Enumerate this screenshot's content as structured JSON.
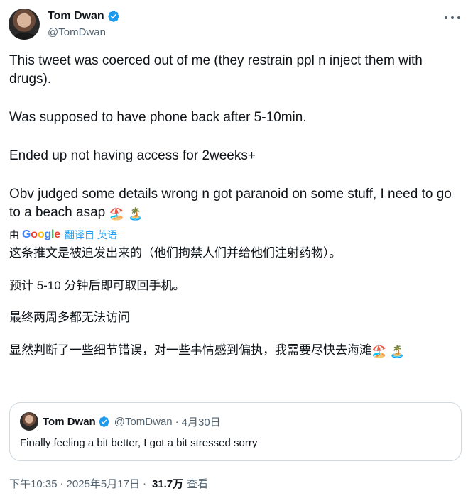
{
  "author": {
    "name": "Tom Dwan",
    "handle": "@TomDwan",
    "verified": true
  },
  "tweet": {
    "paragraphs": [
      "This tweet was coerced out of me (they restrain ppl n inject them with drugs).",
      "Was supposed to have phone back after 5-10min.",
      "Ended up not having access for 2weeks+",
      "Obv judged some details wrong n got paranoid on some stuff, I need to go to a beach asap"
    ],
    "emojis": [
      "🏖️",
      "🏝️"
    ]
  },
  "translation": {
    "by_label": "由",
    "provider": "Google",
    "link_label": "翻译自 英语",
    "paragraphs": [
      "这条推文是被迫发出来的（他们拘禁人们并给他们注射药物）。",
      "预计 5-10 分钟后即可取回手机。",
      "最终两周多都无法访问",
      "显然判断了一些细节错误，对一些事情感到偏执，我需要尽快去海滩"
    ]
  },
  "quoted_tweet": {
    "name": "Tom Dwan",
    "handle": "@TomDwan",
    "separator": "·",
    "date": "4月30日",
    "text": "Finally feeling a bit better, I got a bit stressed sorry"
  },
  "meta": {
    "time": "下午10:35",
    "separator": "·",
    "date": "2025年5月17日",
    "views_count": "31.7万",
    "views_label": "查看"
  },
  "colors": {
    "accent": "#1d9bf0",
    "secondary_text": "#536471",
    "border": "#cfd9de"
  },
  "icons": [
    "verified-badge-icon",
    "more-options-icon",
    "avatar"
  ]
}
